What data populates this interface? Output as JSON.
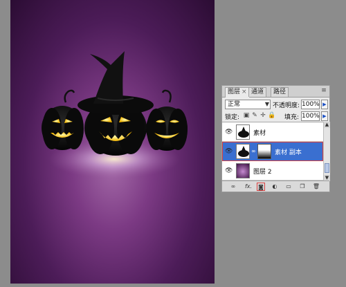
{
  "panel": {
    "tabs": [
      {
        "label": "图层",
        "close": "×"
      },
      {
        "label": "通道"
      },
      {
        "label": "路径"
      }
    ],
    "blend_mode": "正常",
    "opacity_label": "不透明度:",
    "opacity_value": "100%",
    "lock_label": "锁定:",
    "fill_label": "填充:",
    "fill_value": "100%",
    "layers": [
      {
        "name": "素材",
        "visible": true,
        "selected": false,
        "has_mask": false
      },
      {
        "name": "素材 副本",
        "visible": true,
        "selected": true,
        "has_mask": true
      },
      {
        "name": "图层 2",
        "visible": true,
        "selected": false,
        "has_mask": false
      }
    ],
    "bottom_icons": [
      "link-layers-icon",
      "fx-icon",
      "add-mask-icon",
      "adjustment-icon",
      "group-icon",
      "new-layer-icon",
      "trash-icon"
    ],
    "fx_label": "fx."
  },
  "colors": {
    "selection": "#3a6fd0",
    "highlight_border": "#d84040",
    "canvas_center": "#a46aa8",
    "canvas_edge": "#2b0c33"
  }
}
